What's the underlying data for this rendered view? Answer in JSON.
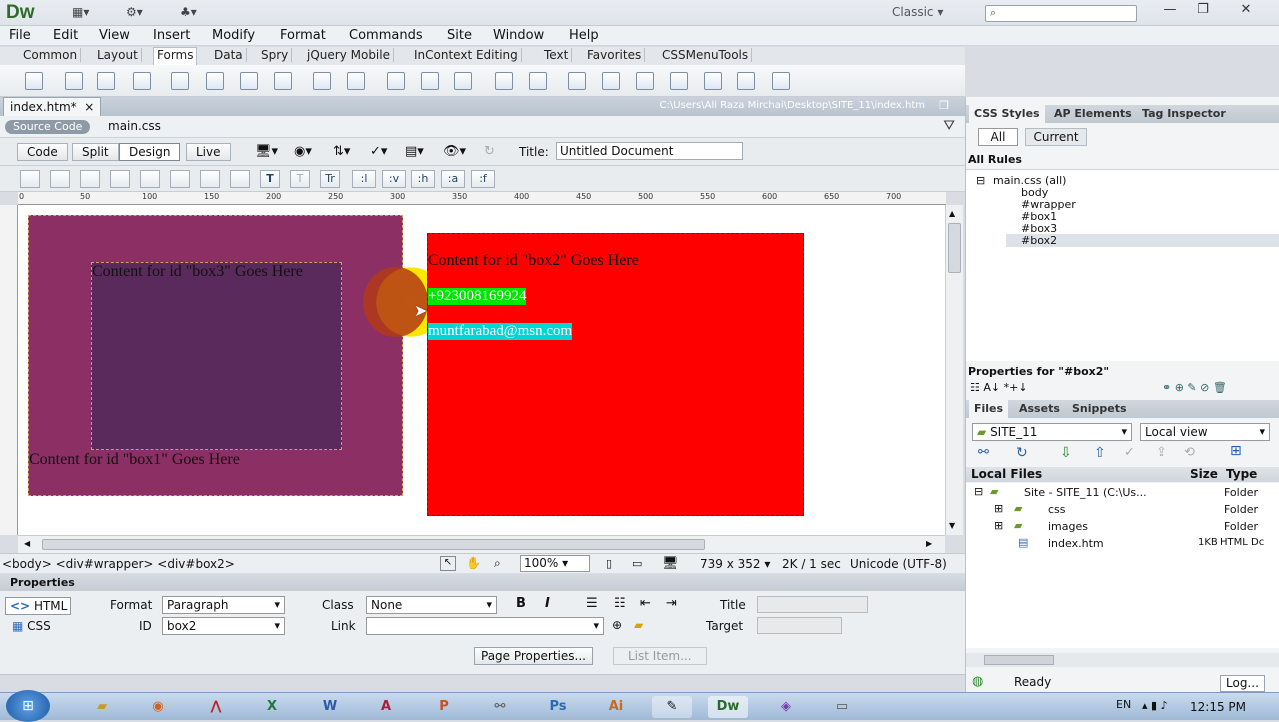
{
  "app": {
    "logo": "Dw",
    "workspace": "Classic",
    "search_placeholder": ""
  },
  "menu": [
    "File",
    "Edit",
    "View",
    "Insert",
    "Modify",
    "Format",
    "Commands",
    "Site",
    "Window",
    "Help"
  ],
  "insert_tabs": [
    "Common",
    "Layout",
    "Forms",
    "Data",
    "Spry",
    "jQuery Mobile",
    "InContext Editing",
    "Text",
    "Favorites",
    "CSSMenuTools"
  ],
  "document": {
    "tab": "index.htm*",
    "close": "×",
    "path": "C:\\Users\\Ali Raza Mirchai\\Desktop\\SITE_11\\index.htm",
    "source_code": "Source Code",
    "related_file": "main.css",
    "views": [
      "Code",
      "Split",
      "Design",
      "Live"
    ],
    "title_label": "Title:",
    "title_value": "Untitled Document"
  },
  "format_buttons": [
    ":l",
    ":v",
    ":h",
    ":a",
    ":f"
  ],
  "ruler": [
    "0",
    "50",
    "100",
    "150",
    "200",
    "250",
    "300",
    "350",
    "400",
    "450",
    "500",
    "550",
    "600",
    "650",
    "700"
  ],
  "canvas": {
    "box3_text": "Content for id \"box3\" Goes Here",
    "box1_text": "Content for id \"box1\" Goes Here",
    "box2_text": "Content for id \"box2\" Goes Here",
    "phone": "+923008169924",
    "email": "muntfarabad@msn.com",
    "colors": {
      "box1": "#8b2f64",
      "box3": "#5b2a5d",
      "box2": "#ff0000",
      "phone_bg": "#00e600",
      "email_bg": "#00d6d6"
    }
  },
  "status": {
    "tag_selector": "<body> <div#wrapper> <div#box2>",
    "zoom": "100%",
    "size": "739 x 352",
    "download": "2K / 1 sec",
    "encoding": "Unicode (UTF-8)"
  },
  "properties": {
    "header": "Properties",
    "html_btn": "HTML",
    "css_btn": "CSS",
    "format_label": "Format",
    "format_value": "Paragraph",
    "class_label": "Class",
    "class_value": "None",
    "id_label": "ID",
    "id_value": "box2",
    "link_label": "Link",
    "title_label": "Title",
    "target_label": "Target",
    "page_props": "Page Properties...",
    "list_item": "List Item..."
  },
  "css_panel": {
    "tabs": [
      "CSS Styles",
      "AP Elements",
      "Tag Inspector"
    ],
    "modes": [
      "All",
      "Current"
    ],
    "all_rules": "All Rules",
    "root": "main.css (all)",
    "rules": [
      "body",
      "#wrapper",
      "#box1",
      "#box3",
      "#box2"
    ],
    "props_for": "Properties for \"#box2\""
  },
  "files_panel": {
    "tabs": [
      "Files",
      "Assets",
      "Snippets"
    ],
    "site": "SITE_11",
    "view": "Local view",
    "columns": [
      "Local Files",
      "Size",
      "Type"
    ],
    "rows": [
      {
        "name": "Site - SITE_11 (C:\\Us...",
        "size": "",
        "type": "Folder"
      },
      {
        "name": "css",
        "size": "",
        "type": "Folder"
      },
      {
        "name": "images",
        "size": "",
        "type": "Folder"
      },
      {
        "name": "index.htm",
        "size": "1KB",
        "type": "HTML Dc"
      }
    ],
    "ready": "Ready",
    "log": "Log..."
  },
  "taskbar": {
    "lang": "EN",
    "time": "12:15 PM"
  }
}
